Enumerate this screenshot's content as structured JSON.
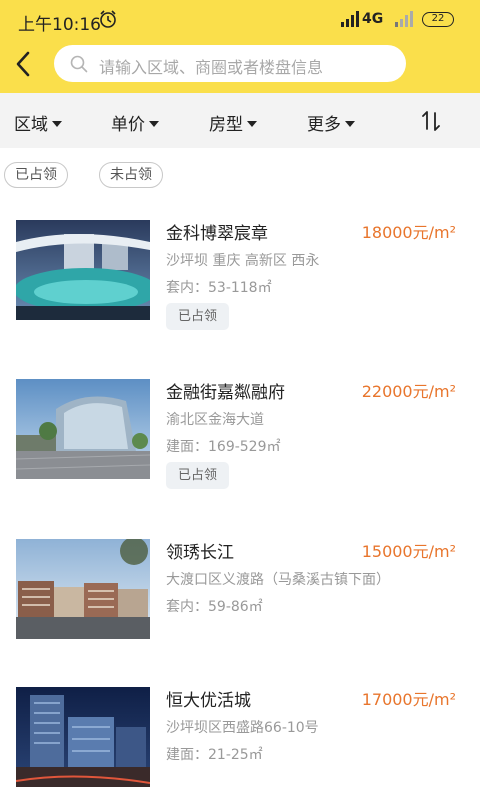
{
  "status_bar": {
    "time": "上午10:16",
    "network": "4G",
    "battery": "22"
  },
  "search": {
    "placeholder": "请输入区域、商圈或者楼盘信息"
  },
  "filters": [
    "区域",
    "单价",
    "房型",
    "更多"
  ],
  "chips": [
    "已占领",
    "未占领"
  ],
  "colors": {
    "header_bg": "#fadf4b",
    "price": "#e8752c",
    "filter_bg": "#f3f3f3",
    "tag_bg": "#eef1f4"
  },
  "icons": [
    "back-arrow-icon",
    "search-icon",
    "caret-down-icon",
    "sort-icon",
    "alarm-icon",
    "signal-icon"
  ],
  "listings": [
    {
      "name": "金科博翠宸章",
      "price": "18000元/m²",
      "location": "沙坪坝 重庆 高新区 西永",
      "area": "套内：53-118㎡",
      "tag": "已占领"
    },
    {
      "name": "金融街嘉粼融府",
      "price": "22000元/m²",
      "location": "渝北区金海大道",
      "area": "建面：169-529㎡",
      "tag": "已占领"
    },
    {
      "name": "领琇长江",
      "price": "15000元/m²",
      "location": "大渡口区义渡路（马桑溪古镇下面）",
      "area": "套内：59-86㎡",
      "tag": ""
    },
    {
      "name": "恒大优活城",
      "price": "17000元/m²",
      "location": "沙坪坝区西盛路66-10号",
      "area": "建面：21-25㎡",
      "tag": ""
    }
  ]
}
